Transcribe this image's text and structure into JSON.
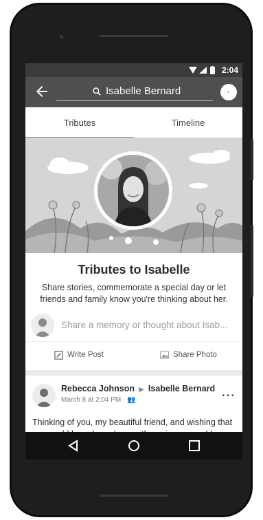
{
  "status_bar": {
    "time": "2:04"
  },
  "app_bar": {
    "search_text": "Isabelle Bernard"
  },
  "tabs": [
    {
      "label": "Tributes",
      "active": true
    },
    {
      "label": "Timeline",
      "active": false
    }
  ],
  "tribute": {
    "title": "Tributes to Isabelle",
    "description": "Share stories, commemorate a special day or let friends and family know you're thinking about her.",
    "share_placeholder": "Share a memory or thought about Isab...",
    "actions": [
      {
        "label": "Write Post",
        "icon": "pencil-icon"
      },
      {
        "label": "Share Photo",
        "icon": "photo-icon"
      }
    ]
  },
  "post": {
    "author": "Rebecca Johnson",
    "target": "Isabelle Bernard",
    "timestamp": "March 8 at 2:04 PM ·",
    "text": "Thinking of you, my beautiful friend, and wishing that you could have been here with me in person. I know"
  },
  "colors": {
    "app_bar": "#4f4f4f",
    "status_bar": "#3b3b3b",
    "cover": "#d5d5d5"
  }
}
